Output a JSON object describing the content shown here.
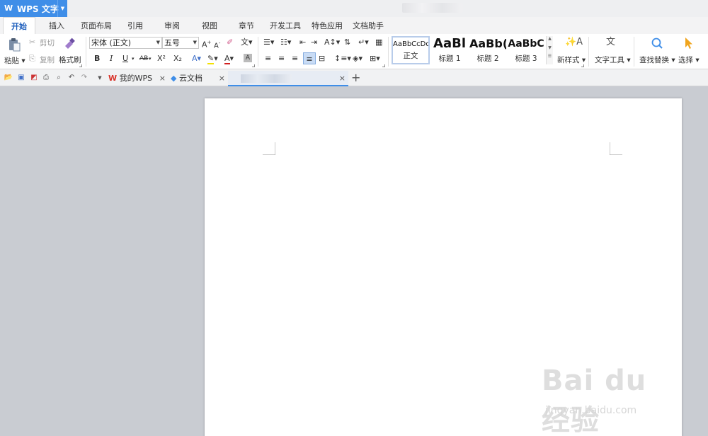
{
  "app": {
    "title": "WPS 文字",
    "logo": "W"
  },
  "menu_tabs": [
    "开始",
    "插入",
    "页面布局",
    "引用",
    "审阅",
    "视图",
    "章节",
    "开发工具",
    "特色应用",
    "文档助手"
  ],
  "ribbon": {
    "paste": "粘贴",
    "cut": "剪切",
    "copy": "复制",
    "format_painter": "格式刷",
    "font_name": "宋体 (正文)",
    "font_size": "五号",
    "bold": "B",
    "italic": "I",
    "underline": "U",
    "strike": "AB",
    "superscript": "X²",
    "subscript": "X₂",
    "styles": [
      {
        "sample": "AaBbCcDd",
        "name": "正文"
      },
      {
        "sample": "AaBl",
        "name": "标题 1"
      },
      {
        "sample": "AaBb(",
        "name": "标题 2"
      },
      {
        "sample": "AaBbC",
        "name": "标题 3"
      }
    ],
    "new_style": "新样式",
    "text_tools": "文字工具",
    "find_replace": "查找替换",
    "select": "选择"
  },
  "doc_tabs": [
    {
      "label": "我的WPS"
    },
    {
      "label": "云文档"
    }
  ],
  "new_tab": "+",
  "watermark": {
    "main": "Bai du 经验",
    "sub": "jingyan.baidu.com"
  },
  "colors": {
    "accent": "#3f8ee8",
    "workspace": "#c9ccd2",
    "active_tab_text": "#1e5fbd"
  }
}
